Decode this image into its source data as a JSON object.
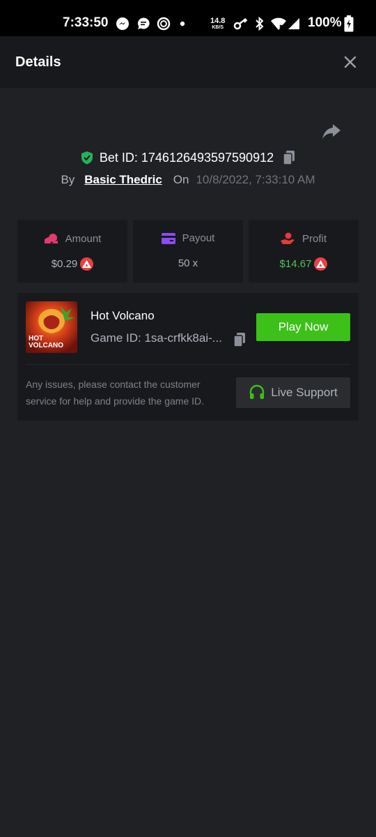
{
  "status_bar": {
    "time": "7:33:50",
    "net_speed_value": "14.8",
    "net_speed_unit": "KB/S",
    "battery": "100%",
    "icons": [
      "messenger-icon",
      "chat-bubble-icon",
      "circle-app-icon",
      "dot-icon",
      "key-icon",
      "bluetooth-icon",
      "wifi-icon",
      "signal-icon",
      "battery-charging-icon"
    ]
  },
  "header": {
    "title": "Details",
    "close_icon": "close-icon"
  },
  "bet": {
    "id_label": "Bet ID: 1746126493597590912",
    "by_label": "By",
    "user": "Basic Thedric",
    "on_label": "On",
    "date": "10/8/2022, 7:33:10 AM"
  },
  "stats": {
    "amount": {
      "label": "Amount",
      "value": "$0.29"
    },
    "payout": {
      "label": "Payout",
      "value": "50 x"
    },
    "profit": {
      "label": "Profit",
      "value": "$14.67"
    }
  },
  "game": {
    "thumb_text_line1": "HOT",
    "thumb_text_line2": "VOLCANO",
    "title": "Hot Volcano",
    "game_id": "Game ID: 1sa-crfkk8ai-...",
    "play_label": "Play Now",
    "help_text": "Any issues, please contact the customer service for help and provide the game ID.",
    "support_label": "Live Support"
  },
  "colors": {
    "background": "#202124",
    "card": "#18191c",
    "accent_green": "#3bc117",
    "profit_green": "#4cc35a",
    "coin_red": "#e84142",
    "shield_green": "#25b25d",
    "amount_pink": "#e23c6f",
    "payout_purple": "#8a4cf5",
    "profit_red": "#e23c3c"
  }
}
